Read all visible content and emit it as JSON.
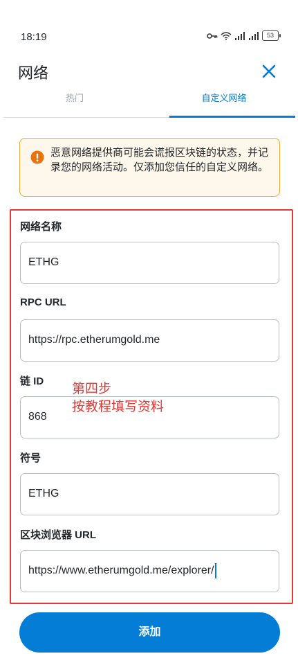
{
  "status_bar": {
    "time": "18:19",
    "battery": "53",
    "icons": [
      "key-icon",
      "wifi-icon",
      "signal-icon",
      "signal-icon",
      "battery-icon"
    ]
  },
  "header": {
    "title": "网络",
    "close_icon": "close-icon"
  },
  "tabs": [
    {
      "label": "热门",
      "active": false
    },
    {
      "label": "自定义网络",
      "active": true
    }
  ],
  "warning": {
    "icon": "alert-icon",
    "text": "恶意网络提供商可能会谎报区块链的状态，并记录您的网络活动。仅添加您信任的自定义网络。"
  },
  "form": {
    "network_name": {
      "label": "网络名称",
      "value": "ETHG"
    },
    "rpc_url": {
      "label": "RPC URL",
      "value": "https://rpc.etherumgold.me"
    },
    "chain_id": {
      "label": "链 ID",
      "value": "868"
    },
    "symbol": {
      "label": "符号",
      "value": "ETHG"
    },
    "explorer_url": {
      "label": "区块浏览器 URL",
      "value": "https://www.etherumgold.me/explorer/"
    }
  },
  "annotation": {
    "line1": "第四步",
    "line2": "按教程填写资料"
  },
  "add_button": {
    "label": "添加"
  },
  "colors": {
    "accent": "#037dd6",
    "warning_border": "#f0a830",
    "warning_bg": "#fef8ec",
    "warning_icon": "#e8730c",
    "annotation_red": "#e53935"
  }
}
